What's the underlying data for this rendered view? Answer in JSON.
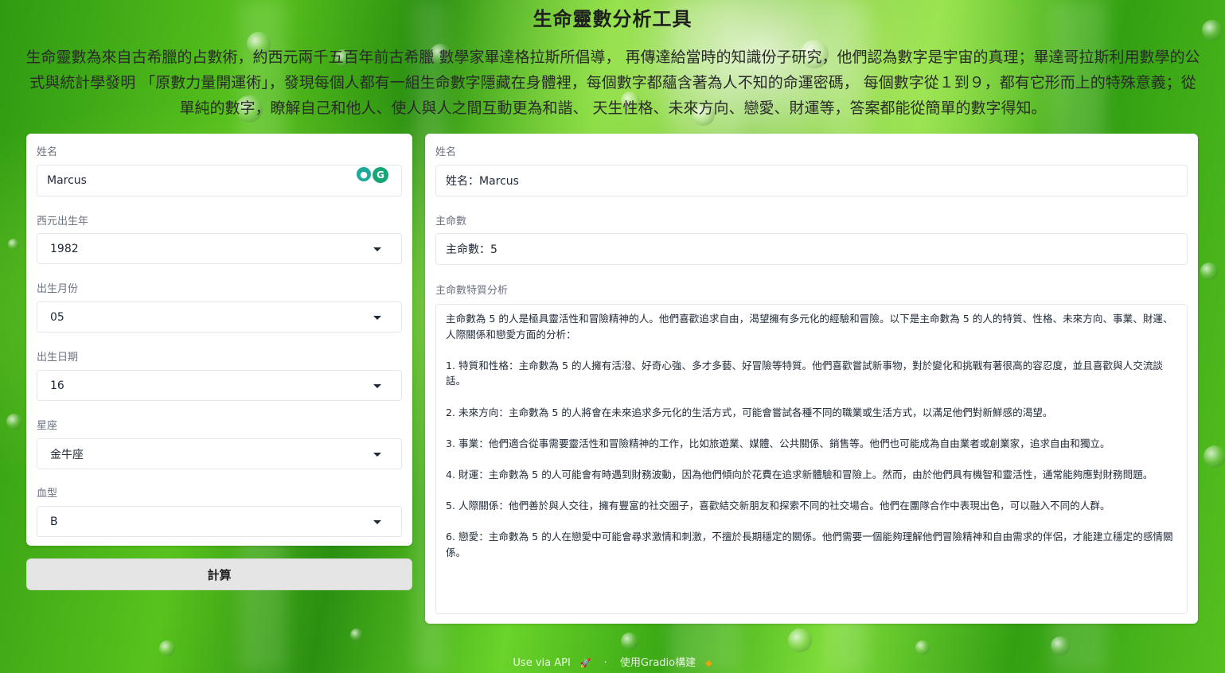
{
  "page": {
    "title": "生命靈數分析工具",
    "intro": "生命靈數為來自古希臘的占數術，約西元兩千五百年前古希臘 數學家畢達格拉斯所倡導， 再傳達給當時的知識份子研究，他們認為數字是宇宙的真理；畢達哥拉斯利用數學的公式與統計學發明 「原數力量開運術」，發現每個人都有一組生命數字隱藏在身體裡，每個數字都蘊含著為人不知的命運密碼， 每個數字從１到９，都有它形而上的特殊意義；從單純的數字，瞭解自己和他人、使人與人之間互動更為和諧、 天生性格、未來方向、戀愛、財運等，答案都能從簡單的數字得知。"
  },
  "inputs": {
    "name": {
      "label": "姓名",
      "value": "Marcus"
    },
    "year": {
      "label": "西元出生年",
      "value": "1982"
    },
    "month": {
      "label": "出生月份",
      "value": "05"
    },
    "day": {
      "label": "出生日期",
      "value": "16"
    },
    "zodiac": {
      "label": "星座",
      "value": "金牛座"
    },
    "blood": {
      "label": "血型",
      "value": "B"
    },
    "submit_label": "計算"
  },
  "outputs": {
    "name": {
      "label": "姓名",
      "value": "姓名：Marcus"
    },
    "main_number": {
      "label": "主命數",
      "value": "主命數：5"
    },
    "analysis": {
      "label": "主命數特質分析",
      "paragraphs": [
        "主命數為 5 的人是極具靈活性和冒險精神的人。他們喜歡追求自由，渴望擁有多元化的經驗和冒險。以下是主命數為 5 的人的特質、性格、未來方向、事業、財運、人際關係和戀愛方面的分析：",
        "1. 特質和性格：主命數為 5 的人擁有活潑、好奇心強、多才多藝、好冒險等特質。他們喜歡嘗試新事物，對於變化和挑戰有著很高的容忍度，並且喜歡與人交流談話。",
        "2. 未來方向：主命數為 5 的人將會在未來追求多元化的生活方式，可能會嘗試各種不同的職業或生活方式，以滿足他們對新鮮感的渴望。",
        "3. 事業：他們適合從事需要靈活性和冒險精神的工作，比如旅遊業、媒體、公共關係、銷售等。他們也可能成為自由業者或創業家，追求自由和獨立。",
        "4. 財運：主命數為 5 的人可能會有時遇到財務波動，因為他們傾向於花費在追求新體驗和冒險上。然而，由於他們具有機智和靈活性，通常能夠應對財務問題。",
        "5. 人際關係：他們善於與人交往，擁有豐富的社交圈子，喜歡結交新朋友和探索不同的社交場合。他們在團隊合作中表現出色，可以融入不同的人群。",
        "6. 戀愛：主命數為 5 的人在戀愛中可能會尋求激情和刺激，不擅於長期穩定的關係。他們需要一個能夠理解他們冒險精神和自由需求的伴侶，才能建立穩定的感情關係。"
      ]
    }
  },
  "footer": {
    "api_link": "Use via API",
    "separator": "·",
    "built_with": "使用Gradio構建"
  },
  "colors": {
    "background_green": "#4cb61a",
    "panel": "#ffffff",
    "button": "#e5e5e5"
  }
}
